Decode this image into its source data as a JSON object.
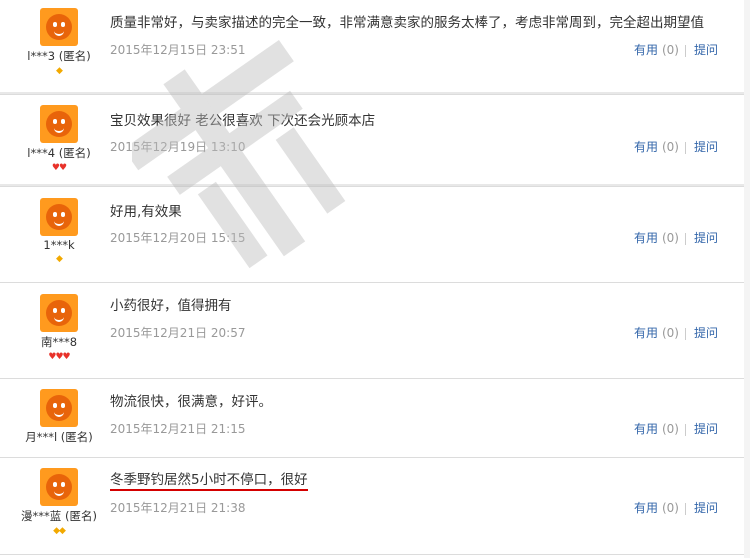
{
  "reviews": [
    {
      "user": "l***3 (匿名)",
      "rank": "◆",
      "rank_type": "gold",
      "content": "质量非常好，与卖家描述的完全一致，非常满意卖家的服务太棒了，考虑非常周到，完全超出期望值",
      "date": "2015年12月15日 23:51",
      "useful_label": "有用",
      "useful_count": "(0)",
      "ask_label": "提问"
    },
    {
      "user": "l***4 (匿名)",
      "rank": "♥♥",
      "rank_type": "heart",
      "content": "宝贝效果很好 老公很喜欢 下次还会光顾本店",
      "date": "2015年12月19日 13:10",
      "useful_label": "有用",
      "useful_count": "(0)",
      "ask_label": "提问"
    },
    {
      "user": "1***k",
      "rank": "◆",
      "rank_type": "gold",
      "content": "好用,有效果",
      "date": "2015年12月20日 15:15",
      "useful_label": "有用",
      "useful_count": "(0)",
      "ask_label": "提问"
    },
    {
      "user": "南***8",
      "rank": "♥♥♥",
      "rank_type": "heart",
      "content": "小药很好，值得拥有",
      "date": "2015年12月21日 20:57",
      "useful_label": "有用",
      "useful_count": "(0)",
      "ask_label": "提问"
    },
    {
      "user": "月***l (匿名)",
      "rank": "",
      "rank_type": "none",
      "content": "物流很快，很满意，好评。",
      "date": "2015年12月21日 21:15",
      "useful_label": "有用",
      "useful_count": "(0)",
      "ask_label": "提问"
    },
    {
      "user": "漫***蓝 (匿名)",
      "rank": "◆◆",
      "rank_type": "gold",
      "content": "冬季野钓居然5小时不停口，很好",
      "date": "2015年12月21日 21:38",
      "useful_label": "有用",
      "useful_count": "(0)",
      "ask_label": "提问"
    }
  ]
}
